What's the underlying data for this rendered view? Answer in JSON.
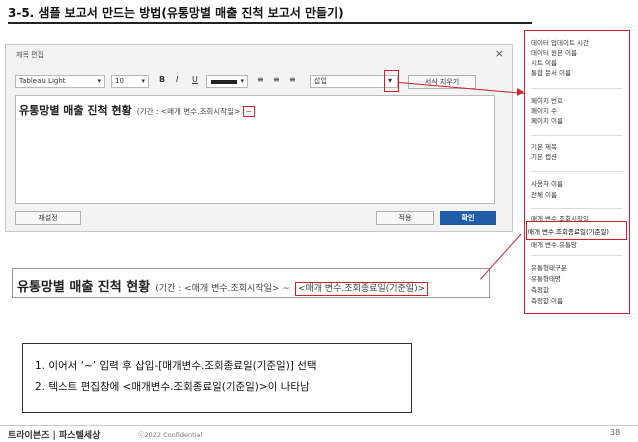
{
  "slide": {
    "title": "3-5. 샘플 보고서 만드는 방법(유통망별 매출 진척 보고서 만들기)"
  },
  "dialog": {
    "title": "제목 편집",
    "close_icon": "×",
    "toolbar": {
      "font": "Tableau Light",
      "size": "10",
      "bold": "B",
      "italic": "I",
      "underline": "U",
      "insert": "삽입",
      "clear_format": "서식 지우기"
    },
    "editor": {
      "main": "유통망별 매출 진척 현황",
      "period": "(기간 : <매개 변수.조회시작일> ",
      "tilde": "~"
    },
    "buttons": {
      "reset": "재설정",
      "apply": "적용",
      "ok": "확인"
    }
  },
  "insert_menu": {
    "groups": [
      [
        "데이터 업데이트 시간",
        "데이터 원본 이름",
        "시트 이름",
        "통합 문서 이름"
      ],
      [
        "페이지 번호",
        "페이지 수",
        "페이지 이름"
      ],
      [
        "기본 제목",
        "기본 캡션"
      ],
      [
        "사용자 이름",
        "전체 이름"
      ],
      [
        "매개 변수.조회시작일",
        "매개 변수.조회종료일(기준일)",
        "매개 변수.유통망"
      ],
      [
        "유통형태구분",
        "유통형태명",
        "측정값",
        "측정값 이름"
      ]
    ]
  },
  "preview": {
    "main": "유통망별 매출 진척 현황",
    "period": "(기간 : <매개 변수.조회시작일> ~",
    "highlight": "<매개 변수.조회종료일(기준일)>"
  },
  "note": {
    "line1": "1.  이어서 ‘~’ 입력 후 삽입-[매개변수.조회종료일(기준일)] 선택",
    "line2": "2.  텍스트 편집창에 <매개변수.조회종료일(기준일)>이 나타남"
  },
  "footer": {
    "brand": "트라이븐즈 | 파스텔세상",
    "copyright": "ⓒ2022 Confidential",
    "page": "38"
  },
  "colors": {
    "highlight_red": "#d0202a",
    "primary_button": "#1f5da8"
  }
}
